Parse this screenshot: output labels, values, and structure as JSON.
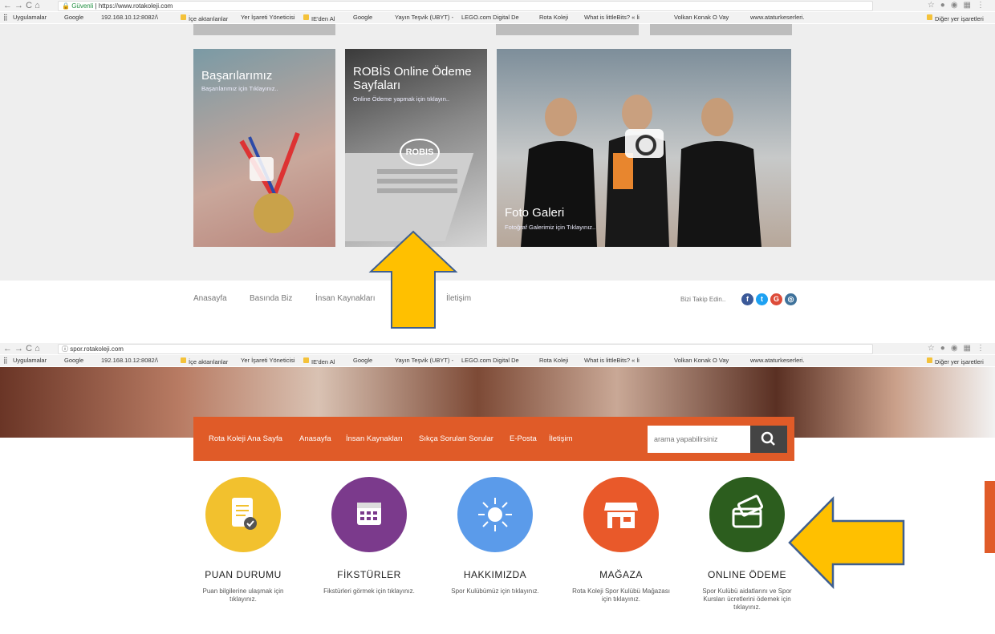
{
  "top_browser": {
    "nav": "←  →  C  ⌂",
    "secure_label": "Güvenli",
    "url": "https://www.rotakoleji.com"
  },
  "bottom_browser": {
    "nav": "←  →  C  ⌂",
    "url": "spor.rotakoleji.com"
  },
  "bookmarks": {
    "items": [
      "Uygulamalar",
      "Google",
      "192.168.10.12:8082/\\",
      "İçe aktarılanlar",
      "Yer İşareti Yöneticisi",
      "IE'den Al",
      "Google",
      "Yayın Teşvik (UBYT) -",
      "LEGO.com Digital De",
      "Rota Koleji",
      "What is littleBits? « li",
      "Volkan Konak O Vay",
      "www.ataturkeserleri."
    ],
    "other": "Diğer yer işaretleri"
  },
  "tiles": [
    {
      "title": "Başarılarımız",
      "sub": "Başarılarımız için Tıklayınız.."
    },
    {
      "title": "ROBİS Online Ödeme Sayfaları",
      "sub": "Online Ödeme yapmak için tıklayın..",
      "logo": "ROBIS"
    },
    {
      "title": "Foto Galeri",
      "sub": "Fotoğraf Galerimiz için Tıklayınız.."
    }
  ],
  "footer": {
    "links": [
      "Anasayfa",
      "Basında Biz",
      "İnsan Kaynakları",
      "İletişim"
    ],
    "follow": "Bizi Takip Edin..",
    "social": [
      "f",
      "t",
      "G",
      "◎"
    ]
  },
  "sport_menu": [
    "Rota Koleji Ana Sayfa",
    "Anasayfa",
    "İnsan Kaynakları",
    "Sıkça Soruları Sorular",
    "E-Posta",
    "İletişim"
  ],
  "search": {
    "placeholder": "arama yapabilirsiniz"
  },
  "features": [
    {
      "title": "PUAN DURUMU",
      "desc": "Puan bilgilerine ulaşmak için tıklayınız.",
      "color": "#f2c12e"
    },
    {
      "title": "FİKSTÜRLER",
      "desc": "Fikstürleri görmek için tıklayınız.",
      "color": "#7b3a8c"
    },
    {
      "title": "HAKKIMIZDA",
      "desc": "Spor Kulübümüz için tıklayınız.",
      "color": "#5b9bea"
    },
    {
      "title": "MAĞAZA",
      "desc": "Rota Koleji Spor Kulübü Mağazası için tıklayınız.",
      "color": "#e9592a"
    },
    {
      "title": "ONLINE ÖDEME",
      "desc": "Spor Kulübü aidatlarını ve Spor Kursları ücretlerini ödemek için tıklayınız.",
      "color": "#2c5d1e"
    }
  ],
  "colors": {
    "highlight_arrow": "#ffc000",
    "arrow_outline": "#3f5f8f",
    "menu_bar": "#e05b28"
  }
}
